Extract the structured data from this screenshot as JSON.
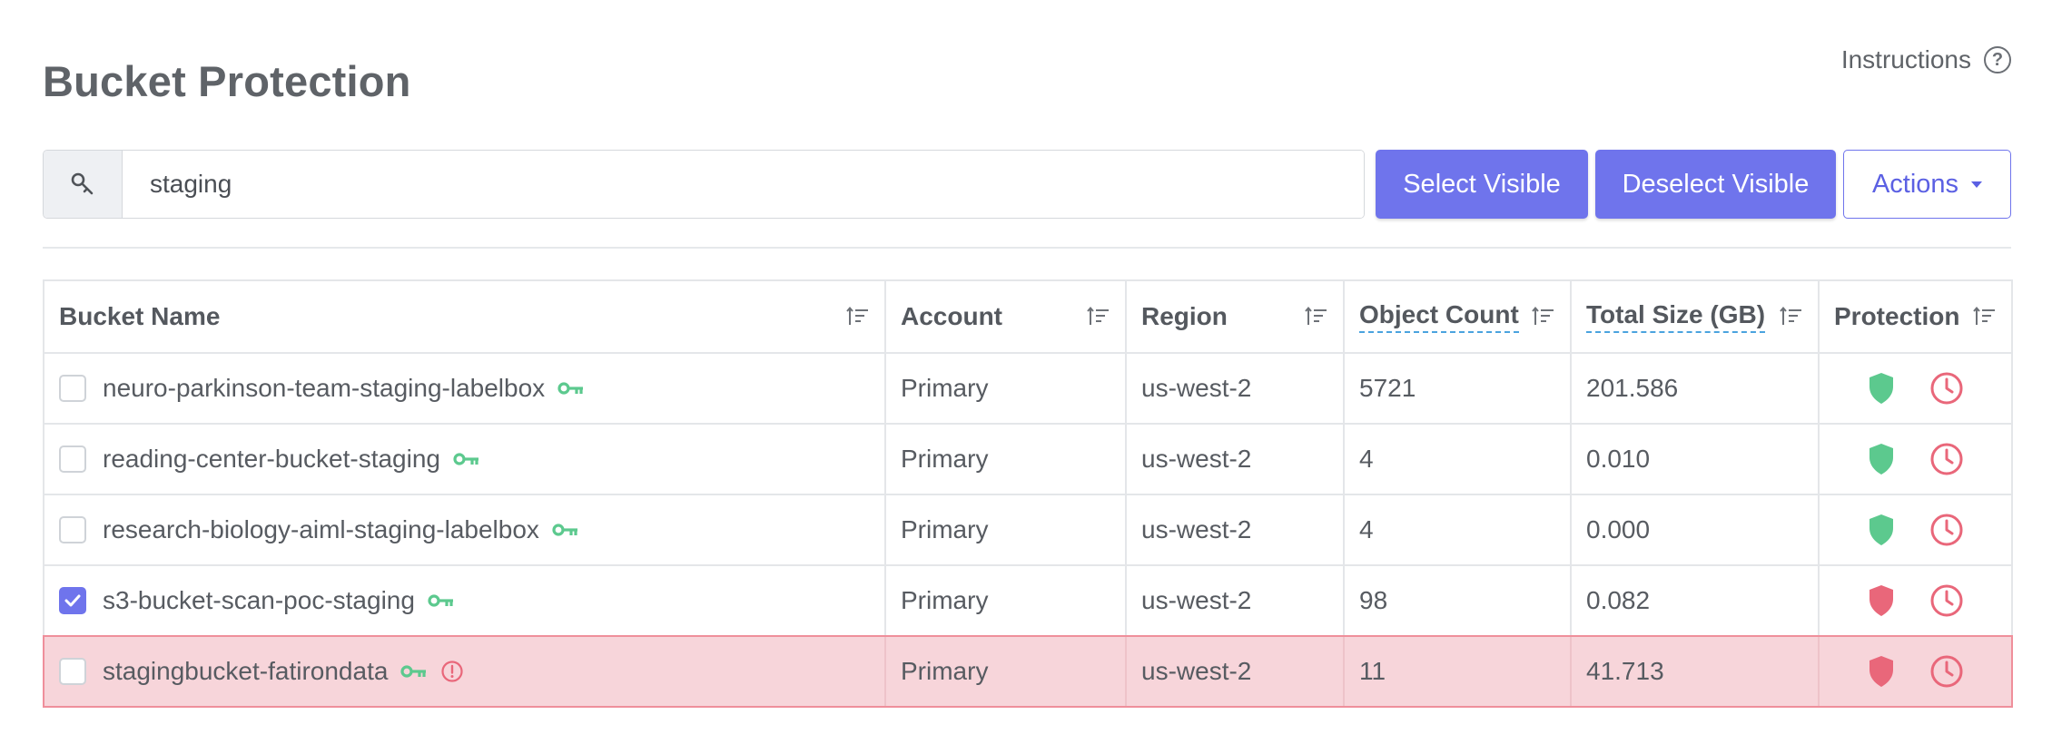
{
  "page": {
    "title": "Bucket Protection",
    "instructions_label": "Instructions",
    "help_glyph": "?"
  },
  "search": {
    "value": "staging",
    "icon": "search-key-icon"
  },
  "toolbar": {
    "select_visible_label": "Select Visible",
    "deselect_visible_label": "Deselect Visible",
    "actions_label": "Actions"
  },
  "colors": {
    "accent": "#6f74ec",
    "shield_ok": "#5cc98e",
    "shield_bad": "#e9677a",
    "clock": "#e9677a",
    "key": "#5cc98e",
    "alert_row_bg": "#f7d5da"
  },
  "table": {
    "columns": [
      {
        "label": "Bucket Name",
        "tooltip": false
      },
      {
        "label": "Account",
        "tooltip": false
      },
      {
        "label": "Region",
        "tooltip": false
      },
      {
        "label": "Object Count",
        "tooltip": true
      },
      {
        "label": "Total Size (GB)",
        "tooltip": true
      },
      {
        "label": "Protection",
        "tooltip": false
      }
    ],
    "rows": [
      {
        "name": "neuro-parkinson-team-staging-labelbox",
        "account": "Primary",
        "region": "us-west-2",
        "object_count": "5721",
        "total_size": "201.586",
        "checked": false,
        "protected": true,
        "warning": false
      },
      {
        "name": "reading-center-bucket-staging",
        "account": "Primary",
        "region": "us-west-2",
        "object_count": "4",
        "total_size": "0.010",
        "checked": false,
        "protected": true,
        "warning": false
      },
      {
        "name": "research-biology-aiml-staging-labelbox",
        "account": "Primary",
        "region": "us-west-2",
        "object_count": "4",
        "total_size": "0.000",
        "checked": false,
        "protected": true,
        "warning": false
      },
      {
        "name": "s3-bucket-scan-poc-staging",
        "account": "Primary",
        "region": "us-west-2",
        "object_count": "98",
        "total_size": "0.082",
        "checked": true,
        "protected": false,
        "warning": false
      },
      {
        "name": "stagingbucket-fatirondata",
        "account": "Primary",
        "region": "us-west-2",
        "object_count": "11",
        "total_size": "41.713",
        "checked": false,
        "protected": false,
        "warning": true
      }
    ]
  }
}
